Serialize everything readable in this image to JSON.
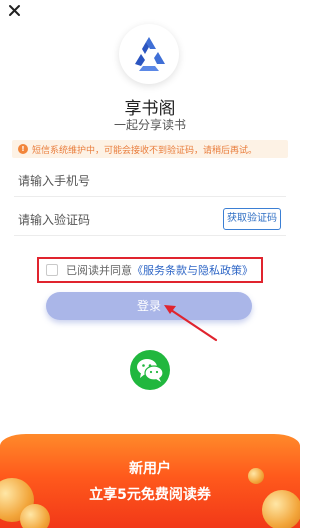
{
  "app": {
    "name": "享书阁",
    "slogan": "一起分享读书"
  },
  "notice": {
    "icon": "warning-dot-icon",
    "text": "短信系统维护中，可能会接收不到验证码，请稍后再试。"
  },
  "form": {
    "phone_placeholder": "请输入手机号",
    "code_placeholder": "请输入验证码",
    "get_code_label": "获取验证码"
  },
  "agreement": {
    "prefix": "已阅读并同意",
    "link": "《服务条款与隐私政策》",
    "checked": false
  },
  "login": {
    "label": "登录"
  },
  "wechat": {
    "icon": "wechat-icon"
  },
  "promo": {
    "line1": "新用户",
    "line2": "立享5元免费阅读券"
  },
  "colors": {
    "accent_blue": "#2e66c6",
    "login_button": "#aab6e8",
    "notice_bg": "#fdf2e5",
    "notice_text": "#e97d3c",
    "highlight_red": "#e0242e",
    "wechat_green": "#21b73e",
    "promo_orange": "#ff5a1c"
  }
}
